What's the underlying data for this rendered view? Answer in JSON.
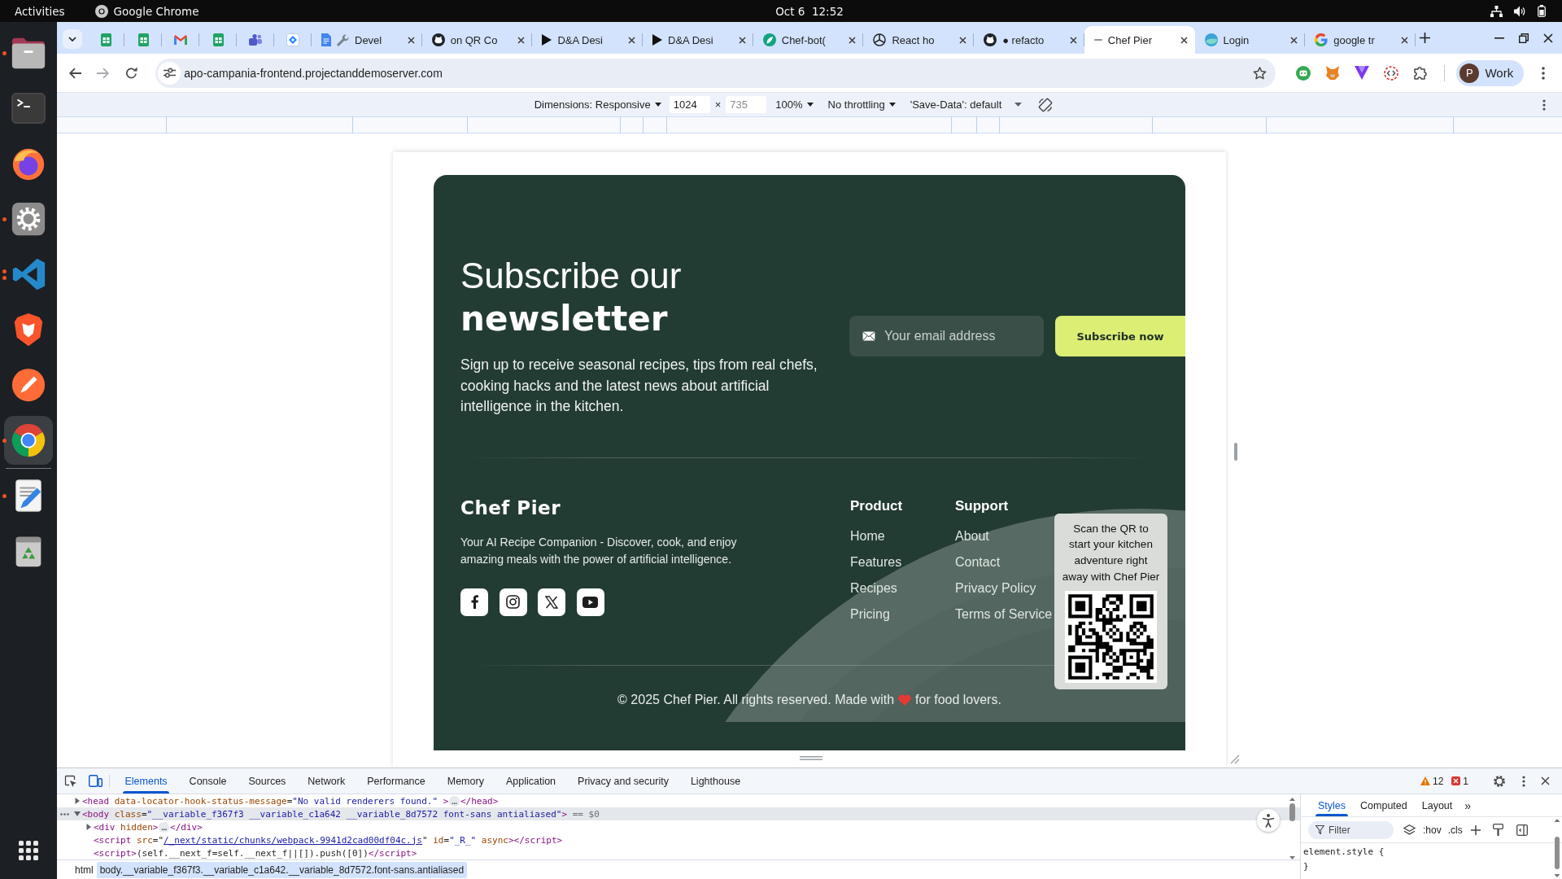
{
  "top_bar": {
    "activities": "Activities",
    "app_name": "Google Chrome",
    "clock": "Oct 6  12:52"
  },
  "dock": {
    "items": [
      {
        "kind": "folder",
        "running": true,
        "multiple_windows": false,
        "selected": false
      },
      {
        "kind": "terminal",
        "running": false,
        "multiple_windows": false,
        "selected": false
      },
      {
        "kind": "globe",
        "running": false,
        "multiple_windows": false,
        "selected": false
      },
      {
        "kind": "settings",
        "running": true,
        "multiple_windows": false,
        "selected": false
      },
      {
        "kind": "code-editor",
        "running": true,
        "multiple_windows": true,
        "selected": false
      },
      {
        "kind": "shield",
        "running": false,
        "multiple_windows": false,
        "selected": false
      },
      {
        "kind": "pen-orb",
        "running": false,
        "multiple_windows": false,
        "selected": false
      },
      {
        "kind": "chrome",
        "running": true,
        "multiple_windows": false,
        "selected": true
      },
      {
        "kind": "separator"
      },
      {
        "kind": "text-editor",
        "running": true,
        "multiple_windows": false,
        "selected": false
      },
      {
        "kind": "recycle-bin",
        "running": false,
        "multiple_windows": false,
        "selected": false
      }
    ]
  },
  "browser": {
    "tabs": [
      {
        "favicons": [
          {
            "kind": "sheet"
          }
        ],
        "selected": false
      },
      {
        "favicons": [
          {
            "kind": "sheet"
          }
        ],
        "selected": false
      },
      {
        "favicons": [
          {
            "kind": "mail"
          }
        ],
        "selected": false
      },
      {
        "favicons": [
          {
            "kind": "sheet"
          }
        ],
        "selected": false
      },
      {
        "favicons": [
          {
            "kind": "people"
          }
        ],
        "selected": false
      },
      {
        "favicons": [
          {
            "kind": "diamond"
          }
        ],
        "selected": false
      },
      {
        "favicons": [
          {
            "kind": "doc"
          },
          {
            "kind": "wrench"
          }
        ],
        "title": "Devel",
        "selected": false
      },
      {
        "favicons": [
          {
            "kind": "github"
          }
        ],
        "title": "on QR Co",
        "selected": false
      },
      {
        "favicons": [
          {
            "kind": "play"
          }
        ],
        "title": "D&A Desi",
        "selected": false
      },
      {
        "favicons": [
          {
            "kind": "play"
          }
        ],
        "title": "D&A Desi",
        "selected": false
      },
      {
        "favicons": [
          {
            "kind": "leaf"
          }
        ],
        "title": "Chef-bot(",
        "selected": false
      },
      {
        "favicons": [
          {
            "kind": "spokes"
          }
        ],
        "title": "React ho",
        "selected": false
      },
      {
        "favicons": [
          {
            "kind": "github"
          }
        ],
        "title": "● refacto",
        "selected": false
      },
      {
        "favicons": [
          {
            "kind": "dash"
          }
        ],
        "title": "Chef Pier",
        "selected": true
      },
      {
        "favicons": [
          {
            "kind": "orb"
          }
        ],
        "title": "Login",
        "selected": false
      },
      {
        "favicons": [
          {
            "kind": "google"
          }
        ],
        "title": "google tr",
        "selected": false
      }
    ],
    "address_bar": {
      "url": "apo-campania-frontend.projectanddemoserver.com"
    },
    "profile": {
      "initial": "P",
      "label": "Work"
    },
    "device_toolbar": {
      "dimensions": "Dimensions: Responsive",
      "width": {
        "value": "1024"
      },
      "times": "×",
      "height": {
        "placeholder": "735"
      },
      "zoom": "100%",
      "throttling": "No throttling",
      "save_data": "'Save-Data': default"
    }
  },
  "page": {
    "newsletter": {
      "title": "Subscribe our **newsletter**",
      "text": "Sign up to receive seasonal recipes, tips from real chefs, cooking hacks and the latest news about artificial intelligence in the kitchen.",
      "email": {
        "placeholder": "Your email address"
      },
      "button": "Subscribe now"
    },
    "footer": {
      "brand": "Chef Pier",
      "tagline": "Your AI Recipe Companion - Discover, cook, and enjoy amazing meals with the power of artificial intelligence.",
      "socials": [
        {
          "kind": "facebook"
        },
        {
          "kind": "instagram"
        },
        {
          "kind": "x"
        },
        {
          "kind": "youtube"
        }
      ],
      "columns": [
        {
          "heading": "Product",
          "links": [
            "Home",
            "Features",
            "Recipes",
            "Pricing"
          ]
        },
        {
          "heading": "Support",
          "links": [
            "About",
            "Contact",
            "Privacy Policy",
            "Terms of Service"
          ]
        }
      ],
      "copyright_before": "© 2025 Chef Pier. All rights reserved. Made with",
      "copyright_after": "for food lovers."
    },
    "qr_widget": {
      "caption": "Scan the QR to\nstart your kitchen\nadventure right\naway with Chef Pier"
    }
  },
  "devtools": {
    "device_mode_on": true,
    "tabs": [
      {
        "label": "Elements",
        "selected": true
      },
      {
        "label": "Console",
        "selected": false
      },
      {
        "label": "Sources",
        "selected": false
      },
      {
        "label": "Network",
        "selected": false
      },
      {
        "label": "Performance",
        "selected": false
      },
      {
        "label": "Memory",
        "selected": false
      },
      {
        "label": "Application",
        "selected": false
      },
      {
        "label": "Privacy and security",
        "selected": false
      },
      {
        "label": "Lighthouse",
        "selected": false
      }
    ],
    "warnings": "12",
    "errors": "1",
    "dom_tree": [
      {
        "expanded": false,
        "selected": false,
        "segments": [
          {
            "kind": "tag",
            "text": "<head"
          },
          {
            "kind": "attr",
            "text": " data-locator-hook-status-message"
          },
          {
            "kind": "plain",
            "text": "="
          },
          {
            "kind": "value",
            "text": "\"No valid renderers found.\""
          },
          {
            "kind": "tag",
            "text": " >"
          },
          {
            "kind": "badge",
            "text": "…"
          },
          {
            "kind": "tag",
            "text": "</head>"
          }
        ]
      },
      {
        "expanded": true,
        "selected": true,
        "segments": [
          {
            "kind": "tag",
            "text": "<body"
          },
          {
            "kind": "attr",
            "text": " class"
          },
          {
            "kind": "plain",
            "text": "="
          },
          {
            "kind": "value",
            "text": "\"__variable_f367f3 __variable_c1a642 __variable_8d7572 font-sans antialiased\""
          },
          {
            "kind": "tag",
            "text": ">"
          },
          {
            "kind": "dim",
            "text": " == $0"
          }
        ],
        "children": [
          {
            "expanded": false,
            "selected": false,
            "segments": [
              {
                "kind": "tag",
                "text": "<div"
              },
              {
                "kind": "attr",
                "text": " hidden"
              },
              {
                "kind": "tag",
                "text": ">"
              },
              {
                "kind": "badge",
                "text": "…"
              },
              {
                "kind": "tag",
                "text": "</div>"
              }
            ]
          },
          {
            "selected": false,
            "segments": [
              {
                "kind": "tag",
                "text": "<script"
              },
              {
                "kind": "attr",
                "text": " src"
              },
              {
                "kind": "plain",
                "text": "=\""
              },
              {
                "kind": "link",
                "text": "/_next/static/chunks/webpack-9941d2cad00df04c.js"
              },
              {
                "kind": "plain",
                "text": "\""
              },
              {
                "kind": "attr",
                "text": " id"
              },
              {
                "kind": "plain",
                "text": "="
              },
              {
                "kind": "value",
                "text": "\"_R_\""
              },
              {
                "kind": "attr",
                "text": " async"
              },
              {
                "kind": "tag",
                "text": "></script>"
              }
            ]
          },
          {
            "selected": false,
            "segments": [
              {
                "kind": "tag",
                "text": "<script>"
              },
              {
                "kind": "plain",
                "text": "(self.__next_f=self.__next_f||[]).push([0])"
              },
              {
                "kind": "tag",
                "text": "</script>"
              }
            ]
          }
        ]
      }
    ],
    "breadcrumbs": [
      {
        "label": "html",
        "selected": false
      },
      {
        "label": "body.__variable_f367f3.__variable_c1a642.__variable_8d7572.font-sans.antialiased",
        "selected": true
      }
    ],
    "styles_pane": {
      "tabs": [
        {
          "label": "Styles",
          "selected": true
        },
        {
          "label": "Computed",
          "selected": false
        },
        {
          "label": "Layout",
          "selected": false
        }
      ],
      "more": "»",
      "filter": {
        "placeholder": "Filter"
      },
      "hov": ":hov",
      "cls": ".cls",
      "rule_lines": [
        "element.style {",
        "}"
      ]
    }
  }
}
